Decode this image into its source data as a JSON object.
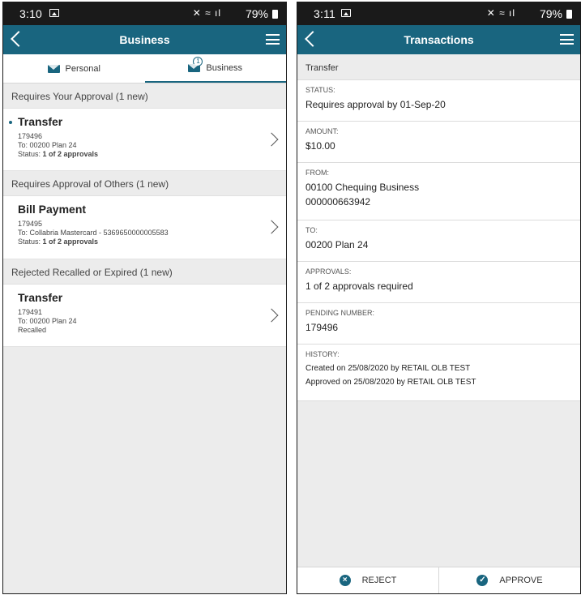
{
  "left": {
    "status_bar": {
      "time": "3:10",
      "battery": "79%"
    },
    "app_bar": {
      "title": "Business"
    },
    "tabs": [
      {
        "label": "Personal",
        "icon": "envelope-icon"
      },
      {
        "label": "Business",
        "icon": "envelope-badge-icon",
        "badge": "1"
      }
    ],
    "sections": [
      {
        "header": "Requires Your Approval (1 new)",
        "items": [
          {
            "name": "Transfer",
            "id": "179496",
            "to": "To: 00200 Plan 24",
            "status_prefix": "Status: ",
            "status_value": "1 of 2 approvals"
          }
        ]
      },
      {
        "header": "Requires Approval of Others (1 new)",
        "items": [
          {
            "name": "Bill Payment",
            "id": "179495",
            "to": "To: Collabria Mastercard - 5369650000005583",
            "status_prefix": "Status: ",
            "status_value": "1 of 2 approvals"
          }
        ]
      },
      {
        "header": "Rejected Recalled or Expired (1 new)",
        "items": [
          {
            "name": "Transfer",
            "id": "179491",
            "to": "To: 00200 Plan 24",
            "status_plain": "Recalled"
          }
        ]
      }
    ]
  },
  "right": {
    "status_bar": {
      "time": "3:11",
      "battery": "79%"
    },
    "app_bar": {
      "title": "Transactions"
    },
    "header": "Transfer",
    "fields": {
      "status": {
        "label": "STATUS:",
        "value": "Requires approval by 01-Sep-20"
      },
      "amount": {
        "label": "AMOUNT:",
        "value": "$10.00"
      },
      "from": {
        "label": "FROM:",
        "value1": "00100 Chequing Business",
        "value2": "000000663942"
      },
      "to": {
        "label": "TO:",
        "value": "00200 Plan 24"
      },
      "approvals": {
        "label": "APPROVALS:",
        "value": "1 of 2 approvals required"
      },
      "pending": {
        "label": "PENDING NUMBER:",
        "value": "179496"
      },
      "history": {
        "label": "HISTORY:",
        "line1": "Created on 25/08/2020 by RETAIL OLB TEST",
        "line2": "Approved on 25/08/2020 by RETAIL OLB TEST"
      }
    },
    "actions": {
      "reject": "REJECT",
      "approve": "APPROVE"
    }
  },
  "colors": {
    "accent": "#19657f",
    "statusbar": "#1a1a1a",
    "background": "#ececec"
  }
}
